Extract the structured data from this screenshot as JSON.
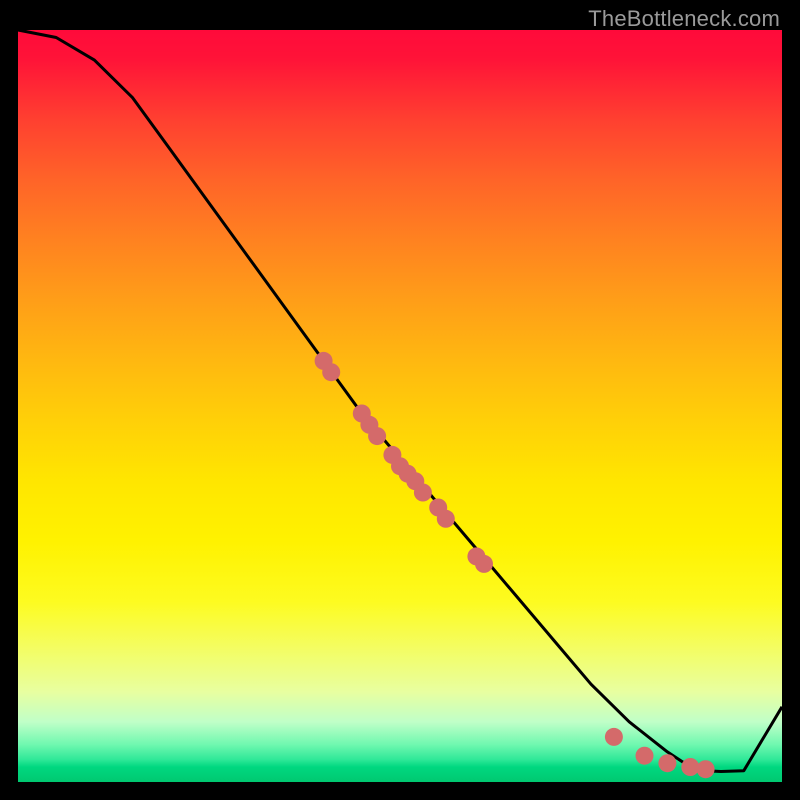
{
  "attribution": "TheBottleneck.com",
  "chart_data": {
    "type": "line",
    "title": "",
    "xlabel": "",
    "ylabel": "",
    "xlim": [
      0,
      100
    ],
    "ylim": [
      0,
      100
    ],
    "grid": false,
    "legend": false,
    "background_gradient": {
      "top": "#ff0a3a",
      "mid": "#ffe600",
      "bottom": "#00c870"
    },
    "series": [
      {
        "name": "curve",
        "color": "#000000",
        "x": [
          0,
          5,
          10,
          15,
          20,
          25,
          30,
          35,
          40,
          45,
          50,
          55,
          60,
          65,
          70,
          75,
          80,
          85,
          88,
          90,
          92,
          95,
          100
        ],
        "y": [
          100,
          99,
          96,
          91,
          84,
          77,
          70,
          63,
          56,
          49,
          43,
          37,
          31,
          25,
          19,
          13,
          8,
          4,
          2,
          1.5,
          1.4,
          1.5,
          10
        ]
      }
    ],
    "markers": {
      "name": "highlight-dots",
      "color": "#d46a6a",
      "radius": 9,
      "points": [
        {
          "x": 40,
          "y": 56
        },
        {
          "x": 41,
          "y": 54.5
        },
        {
          "x": 45,
          "y": 49
        },
        {
          "x": 46,
          "y": 47.5
        },
        {
          "x": 47,
          "y": 46
        },
        {
          "x": 49,
          "y": 43.5
        },
        {
          "x": 50,
          "y": 42
        },
        {
          "x": 51,
          "y": 41
        },
        {
          "x": 52,
          "y": 40
        },
        {
          "x": 53,
          "y": 38.5
        },
        {
          "x": 55,
          "y": 36.5
        },
        {
          "x": 56,
          "y": 35
        },
        {
          "x": 60,
          "y": 30
        },
        {
          "x": 61,
          "y": 29
        },
        {
          "x": 78,
          "y": 6
        },
        {
          "x": 82,
          "y": 3.5
        },
        {
          "x": 85,
          "y": 2.5
        },
        {
          "x": 88,
          "y": 2
        },
        {
          "x": 90,
          "y": 1.7
        }
      ]
    }
  }
}
